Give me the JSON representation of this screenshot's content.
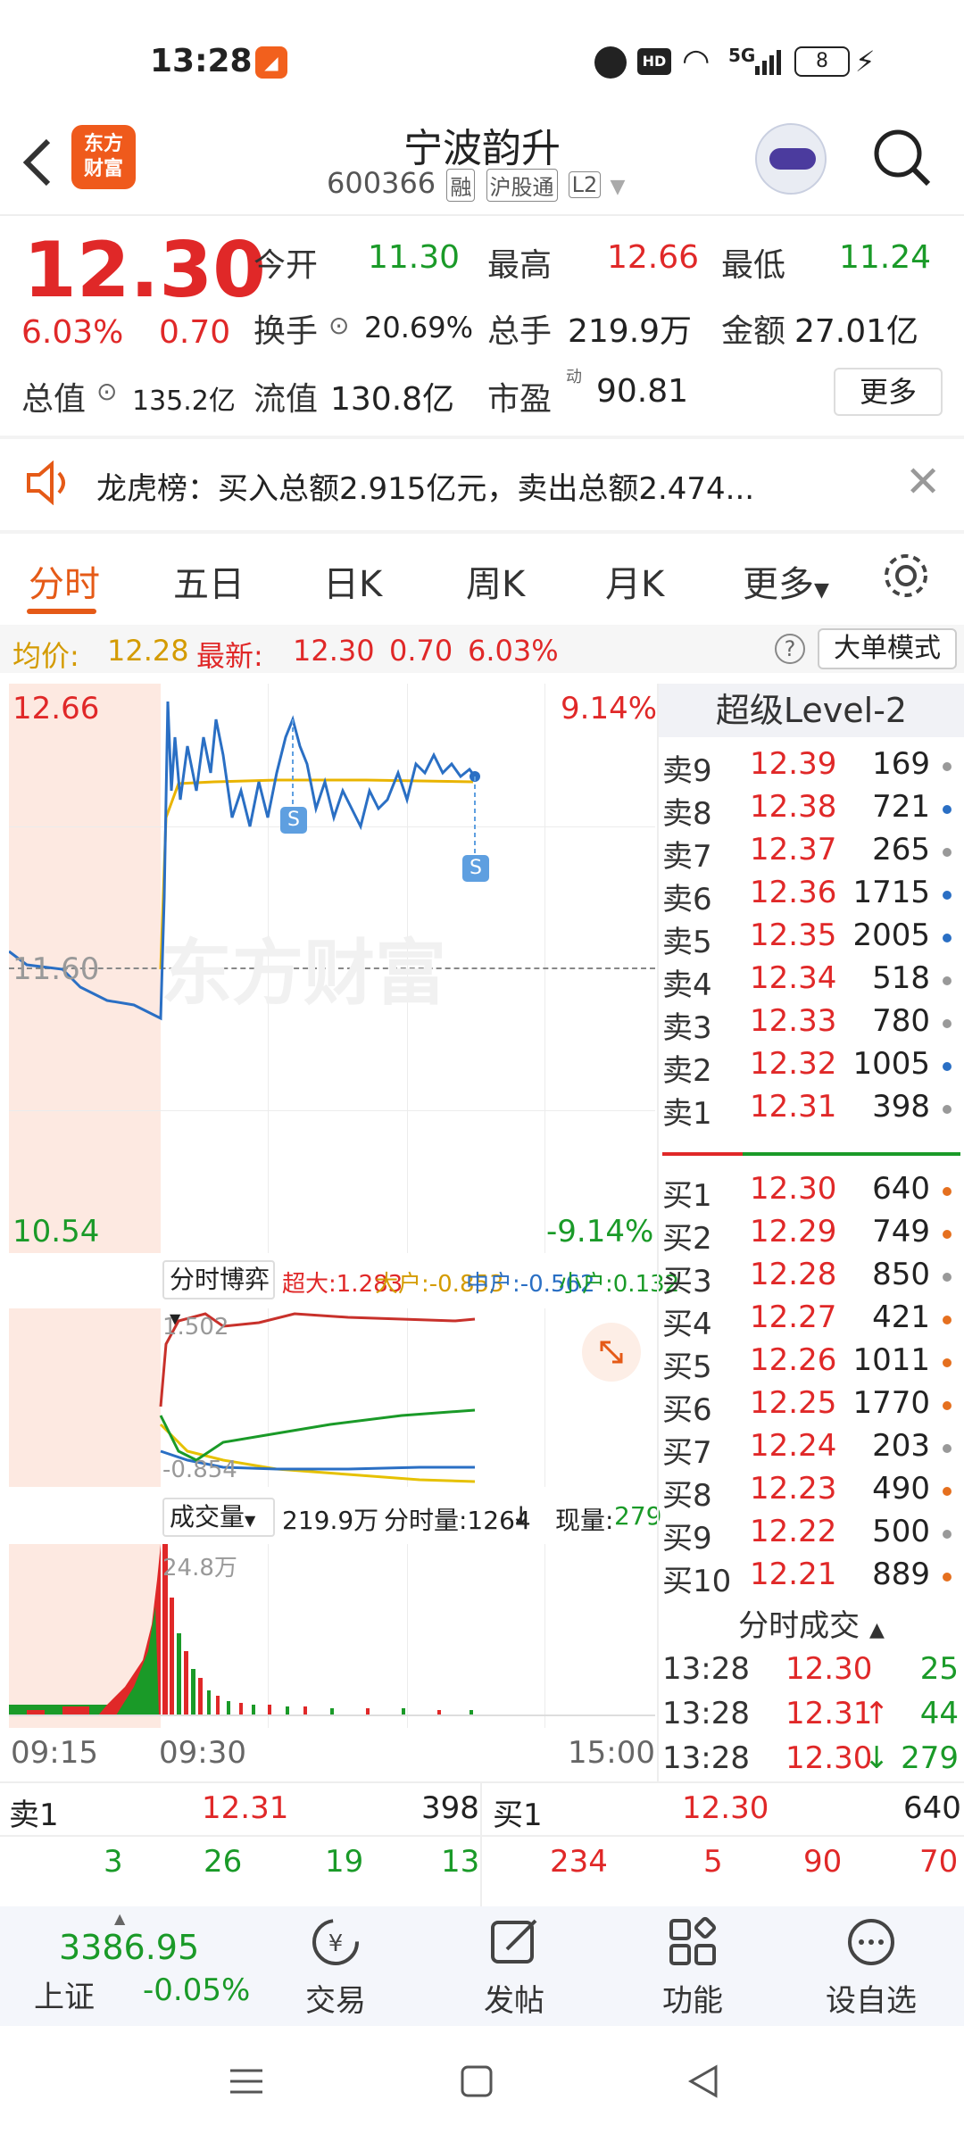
{
  "status": {
    "time": "13:28",
    "battery": "8",
    "signal": "5G"
  },
  "header": {
    "back_icon": "chevron-left-icon",
    "logo_line1": "东方",
    "logo_line2": "财富",
    "title": "宁波韵升",
    "code": "600366",
    "tags": [
      "融",
      "沪股通",
      "L2"
    ]
  },
  "quote": {
    "price": "12.30",
    "change_pct": "6.03%",
    "change_amt": "0.70",
    "open_label": "今开",
    "open": "11.30",
    "high_label": "最高",
    "high": "12.66",
    "low_label": "最低",
    "low": "11.24",
    "turnover_label": "换手",
    "turnover": "20.69%",
    "volume_label": "总手",
    "volume": "219.9万",
    "amount_label": "金额",
    "amount": "27.01亿",
    "mktcap_label": "总值",
    "mktcap": "135.2亿",
    "float_label": "流值",
    "float": "130.8亿",
    "pe_label": "市盈",
    "pe_sup": "动",
    "pe": "90.81",
    "more_button": "更多"
  },
  "banner": {
    "text": "龙虎榜：买入总额2.915亿元，卖出总额2.474..."
  },
  "tabs": [
    "分时",
    "五日",
    "日K",
    "周K",
    "月K",
    "更多"
  ],
  "avg": {
    "avg_label": "均价:",
    "avg": "12.28",
    "last_label": "最新:",
    "last": "12.30",
    "change": "0.70",
    "pct": "6.03%",
    "mode_button": "大单模式"
  },
  "chart": {
    "top_left": "12.66",
    "top_right": "9.14%",
    "mid": "11.60",
    "bottom_left": "10.54",
    "bottom_right": "-9.14%",
    "watermark": "东方财富",
    "marker": "S"
  },
  "flow": {
    "dropdown": "分时博弈",
    "super": "超大:1.283",
    "big": "大户:-0.853",
    "mid": "中户:-0.562",
    "small": "小户:0.132",
    "top_val": "1.502",
    "bottom_val": "-0.854"
  },
  "volume": {
    "dropdown": "成交量",
    "total": "219.9万",
    "period": "分时量:1264",
    "current_label": "现量:",
    "current": "279",
    "peak": "24.8万",
    "time_start": "09:15",
    "time_open": "09:30",
    "time_end": "15:00"
  },
  "level2": {
    "title": "超级Level-2",
    "asks": [
      {
        "label": "卖9",
        "price": "12.39",
        "vol": "169",
        "dot": "#999999"
      },
      {
        "label": "卖8",
        "price": "12.38",
        "vol": "721",
        "dot": "#2a6fc4"
      },
      {
        "label": "卖7",
        "price": "12.37",
        "vol": "265",
        "dot": "#999999"
      },
      {
        "label": "卖6",
        "price": "12.36",
        "vol": "1715",
        "dot": "#2a6fc4"
      },
      {
        "label": "卖5",
        "price": "12.35",
        "vol": "2005",
        "dot": "#2a6fc4"
      },
      {
        "label": "卖4",
        "price": "12.34",
        "vol": "518",
        "dot": "#999999"
      },
      {
        "label": "卖3",
        "price": "12.33",
        "vol": "780",
        "dot": "#999999"
      },
      {
        "label": "卖2",
        "price": "12.32",
        "vol": "1005",
        "dot": "#2a6fc4"
      },
      {
        "label": "卖1",
        "price": "12.31",
        "vol": "398",
        "dot": "#999999"
      }
    ],
    "bids": [
      {
        "label": "买1",
        "price": "12.30",
        "vol": "640",
        "dot": "#e5701f"
      },
      {
        "label": "买2",
        "price": "12.29",
        "vol": "749",
        "dot": "#e5701f"
      },
      {
        "label": "买3",
        "price": "12.28",
        "vol": "850",
        "dot": "#999999"
      },
      {
        "label": "买4",
        "price": "12.27",
        "vol": "421",
        "dot": "#e5701f"
      },
      {
        "label": "买5",
        "price": "12.26",
        "vol": "1011",
        "dot": "#e5701f"
      },
      {
        "label": "买6",
        "price": "12.25",
        "vol": "1770",
        "dot": "#e5701f"
      },
      {
        "label": "买7",
        "price": "12.24",
        "vol": "203",
        "dot": "#999999"
      },
      {
        "label": "买8",
        "price": "12.23",
        "vol": "490",
        "dot": "#e5701f"
      },
      {
        "label": "买9",
        "price": "12.22",
        "vol": "500",
        "dot": "#999999"
      },
      {
        "label": "买10",
        "price": "12.21",
        "vol": "889",
        "dot": "#e5701f"
      }
    ],
    "trades_title": "分时成交",
    "trades": [
      {
        "time": "13:28",
        "price": "12.30",
        "vol": "25",
        "arrow": ""
      },
      {
        "time": "13:28",
        "price": "12.31",
        "vol": "44",
        "arrow": "↑"
      },
      {
        "time": "13:28",
        "price": "12.30",
        "vol": "279",
        "arrow": "↓"
      }
    ]
  },
  "summary": {
    "ask_label": "卖1",
    "ask_price": "12.31",
    "ask_vol": "398",
    "bid_label": "买1",
    "bid_price": "12.30",
    "bid_vol": "640",
    "ask_detail": [
      "3",
      "26",
      "19",
      "13"
    ],
    "bid_detail": [
      "234",
      "5",
      "90",
      "70"
    ]
  },
  "nav": {
    "index_value": "3386.95",
    "index_name": "上证",
    "index_change": "-0.05%",
    "items": [
      "交易",
      "发帖",
      "功能",
      "设自选"
    ]
  },
  "colors": {
    "up": "#e02828",
    "down": "#1a9a28",
    "accent": "#e55a17"
  }
}
